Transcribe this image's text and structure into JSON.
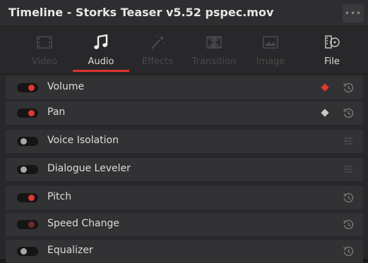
{
  "window": {
    "title": "Timeline - Storks Teaser v5.52 pspec.mov",
    "more_label": "•••"
  },
  "tabs": [
    {
      "label": "Video",
      "icon": "video-film-icon",
      "enabled": false
    },
    {
      "label": "Audio",
      "icon": "music-note-icon",
      "enabled": true,
      "active": true
    },
    {
      "label": "Effects",
      "icon": "magic-wand-icon",
      "enabled": false
    },
    {
      "label": "Transition",
      "icon": "transition-icon",
      "enabled": false
    },
    {
      "label": "Image",
      "icon": "image-icon",
      "enabled": false
    },
    {
      "label": "File",
      "icon": "file-reel-icon",
      "enabled": true
    }
  ],
  "rows": [
    {
      "label": "Volume",
      "toggle": "on",
      "keyframe": "red",
      "action_icon": "reset-icon"
    },
    {
      "label": "Pan",
      "toggle": "on",
      "keyframe": "gray",
      "action_icon": "reset-icon"
    },
    {
      "label": "Voice Isolation",
      "toggle": "off",
      "action_icon": "adjust-icon"
    },
    {
      "label": "Dialogue Leveler",
      "toggle": "off",
      "action_icon": "adjust-icon"
    },
    {
      "label": "Pitch",
      "toggle": "on",
      "action_icon": "reset-icon"
    },
    {
      "label": "Speed Change",
      "toggle": "dim",
      "action_icon": "reset-icon"
    },
    {
      "label": "Equalizer",
      "toggle": "off",
      "action_icon": "reset-icon"
    }
  ],
  "colors": {
    "accent": "#e2372f",
    "keyframe_red": "#e2372f",
    "keyframe_gray": "#c8c8c8",
    "panel_bg": "#28282a",
    "row_bg": "#323234"
  }
}
